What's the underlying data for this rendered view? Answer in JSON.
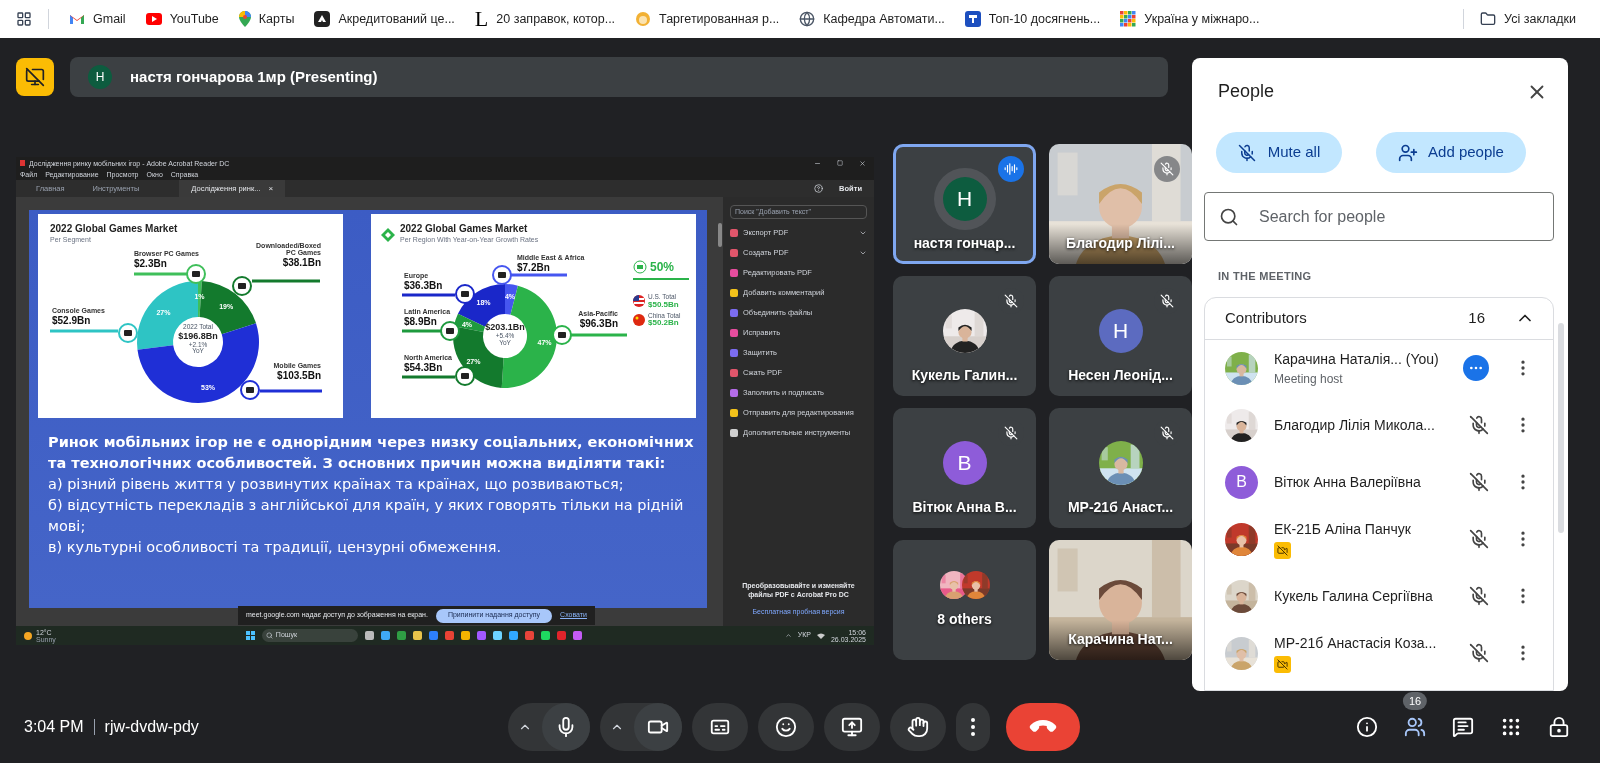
{
  "bookmarks_bar": {
    "items": [
      {
        "label": "Gmail",
        "kind": "gmail"
      },
      {
        "label": "YouTube",
        "kind": "youtube"
      },
      {
        "label": "Карты",
        "kind": "maps"
      },
      {
        "label": "Акредитований це...",
        "kind": "dark"
      },
      {
        "label": "20 заправок, котор...",
        "kind": "letter",
        "glyph": "L"
      },
      {
        "label": "Таргетированная р...",
        "kind": "emoji"
      },
      {
        "label": "Кафедра Автомати...",
        "kind": "globe"
      },
      {
        "label": "Топ-10 досягнень...",
        "kind": "blue"
      },
      {
        "label": "Україна у міжнаро...",
        "kind": "tiles"
      }
    ],
    "all_bookmarks": "Усі закладки"
  },
  "presenter_bar": {
    "avatar_letter": "Н",
    "title": "настя гончарова 1мр (Presenting)"
  },
  "shared_screen": {
    "window_title": "Дослідження ринку мобільних ігор - Adobe Acrobat Reader DC",
    "menu": [
      "Файл",
      "Редактирование",
      "Просмотр",
      "Окно",
      "Справка"
    ],
    "tabs": [
      {
        "label": "Главная",
        "selected": false
      },
      {
        "label": "Инструменты",
        "selected": false
      },
      {
        "label": "Дослідження ринк...",
        "selected": true,
        "close": "×"
      }
    ],
    "sign_in": "Войти",
    "tools_search_placeholder": "Поиск \"Добавить текст\"",
    "tools": [
      {
        "label": "Экспорт PDF",
        "color": "#e0566b",
        "has_menu": true
      },
      {
        "label": "Создать PDF",
        "color": "#e0566b",
        "has_menu": true
      },
      {
        "label": "Редактировать PDF",
        "color": "#e64d9e",
        "has_menu": false
      },
      {
        "label": "Добавить комментарий",
        "color": "#f2c21b",
        "has_menu": false
      },
      {
        "label": "Объединить файлы",
        "color": "#7b6cf0",
        "has_menu": false
      },
      {
        "label": "Исправить",
        "color": "#e64d9e",
        "has_menu": false
      },
      {
        "label": "Защитить",
        "color": "#7b6cf0",
        "has_menu": false
      },
      {
        "label": "Сжать PDF",
        "color": "#e0566b",
        "has_menu": false
      },
      {
        "label": "Заполнить и подписать",
        "color": "#b36ce8",
        "has_menu": false
      },
      {
        "label": "Отправить для редактирования",
        "color": "#f2c21b",
        "has_menu": false
      },
      {
        "label": "Дополнительные инструменты",
        "color": "#cfcfcf",
        "has_menu": false
      }
    ],
    "promo": {
      "text": "Преобразовывайте и изменяйте файлы PDF с Acrobat Pro DC",
      "link": "Бесплатная пробная версия"
    },
    "slide": {
      "charts": [
        {
          "chart_data": {
            "type": "donut",
            "title": "2022 Global Games Market",
            "subtitle": "Per Segment",
            "categories": [
              "Browser PC Games",
              "Downloaded/Boxed PC Games",
              "Console Games",
              "Mobile Games"
            ],
            "values": [
              1,
              19,
              27,
              53
            ],
            "colors": [
              "#3fbf5a",
              "#137a2d",
              "#2ec4c4",
              "#1f2fd6"
            ],
            "value_labels": [
              "1%",
              "19%",
              "27%",
              "53%"
            ]
          },
          "center": {
            "caption": "2022 Total",
            "value": "$196.8Bn",
            "change": "+2.1%",
            "unit": "YoY"
          },
          "callout_values": [
            "$2.3Bn",
            "$38.1Bn",
            "$52.9Bn",
            "$103.5Bn"
          ]
        },
        {
          "chart_data": {
            "type": "donut",
            "title": "2022 Global Games Market",
            "subtitle": "Per Region With Year-on-Year Growth Rates",
            "categories": [
              "Europe",
              "Middle East & Africa",
              "Latin America",
              "Asia-Pacific",
              "North America"
            ],
            "values": [
              18,
              4,
              4,
              47,
              27
            ],
            "colors": [
              "#1a27c9",
              "#4656f0",
              "#1e9a3e",
              "#2bb34a",
              "#137a2d"
            ],
            "value_labels": [
              "18%",
              "4%",
              "4%",
              "47%",
              "27%"
            ]
          },
          "center": {
            "value": "$203.1Bn",
            "change": "+5.4%",
            "unit": "YoY"
          },
          "callout_values": [
            "$36.3Bn",
            "$7.2Bn",
            "$8.9Bn",
            "$96.3Bn",
            "$54.3Bn"
          ],
          "highlight": {
            "value": "50%",
            "items": [
              {
                "label": "U.S. Total",
                "value": "$50.5Bn",
                "kind": "us"
              },
              {
                "label": "China Total",
                "value": "$50.2Bn",
                "kind": "cn"
              }
            ]
          }
        }
      ],
      "heading": "Ринок мобільних ігор не є однорідним через низку соціальних, економічних та технологічних особливостей. З основних причин можна виділяти такі:",
      "points": [
        "а) різний рівень життя у розвинутих країнах та країнах, що розвиваються;",
        "б) відсутність перекладів з англійської для країн, у яких говорять тільки на рідній мові;",
        "в) культурні особливості та традиції, цензурні обмеження."
      ]
    },
    "share_notice": {
      "text": "meet.google.com надає доступ до зображення на екран.",
      "stop_button": "Припинити надання доступу",
      "hide_link": "Сховати"
    },
    "taskbar": {
      "temperature": "12°C",
      "weather": "Sunny",
      "search_placeholder": "Пошук",
      "language": "УКР",
      "time": "15:06",
      "date": "26.03.2025"
    }
  },
  "tiles": [
    {
      "name": "настя гончар...",
      "kind": "avatar",
      "letter": "Н",
      "color": "#0d5c3f",
      "speaking": true,
      "muted": false
    },
    {
      "name": "Благодир Лілі...",
      "kind": "video",
      "muted": true
    },
    {
      "name": "Кукель Галин...",
      "muted": true
    },
    {
      "name": "Несен Леонід...",
      "kind": "avatar",
      "letter": "Н",
      "color": "#5c6bc0",
      "muted": true
    },
    {
      "name": "Вітюк Анна В...",
      "kind": "avatar",
      "letter": "В",
      "color": "#8e5cd9",
      "muted": true
    },
    {
      "name": "МР-21б Анаст...",
      "muted": true
    },
    {
      "name": "8 others",
      "kind": "others",
      "muted": false
    },
    {
      "name": "Карачина Нат...",
      "kind": "video",
      "muted": false
    }
  ],
  "people_panel": {
    "title": "People",
    "mute_all": "Mute all",
    "add_people": "Add people",
    "search_placeholder": "Search for people",
    "section": "IN THE MEETING",
    "group": {
      "label": "Contributors",
      "count": "16",
      "expanded": true
    },
    "participants": [
      {
        "name": "Карачина Наталія... (You)",
        "subtitle": "Meeting host",
        "muted": false,
        "camera_off": false
      },
      {
        "name": "Благодир Лілія Микола...",
        "muted": true,
        "camera_off": false
      },
      {
        "name": "Вітюк Анна Валеріївна",
        "kind": "avatar",
        "letter": "В",
        "color": "#8e5cd9",
        "muted": true,
        "camera_off": false
      },
      {
        "name": "ЕК-21Б Аліна Панчук",
        "muted": true,
        "camera_off": true
      },
      {
        "name": "Кукель Галина Сергіївна",
        "muted": true,
        "camera_off": false
      },
      {
        "name": "МР-21б Анастасія Коза...",
        "muted": true,
        "camera_off": true
      }
    ]
  },
  "bottom_bar": {
    "time": "3:04 PM",
    "meeting_code": "rjw-dvdw-pdy",
    "controls": [
      {
        "kind": "mic",
        "menu": true
      },
      {
        "kind": "camera",
        "menu": true
      },
      {
        "kind": "captions",
        "menu": false
      },
      {
        "kind": "reactions",
        "menu": false
      },
      {
        "kind": "present",
        "menu": false
      },
      {
        "kind": "hand",
        "menu": false
      },
      {
        "kind": "more",
        "menu": false
      },
      {
        "kind": "leave",
        "menu": false
      }
    ],
    "side": [
      {
        "kind": "info",
        "selected": false
      },
      {
        "kind": "people",
        "selected": true,
        "badge": "16"
      },
      {
        "kind": "chat",
        "selected": false
      },
      {
        "kind": "activities",
        "selected": false
      },
      {
        "kind": "host",
        "selected": false
      }
    ]
  }
}
